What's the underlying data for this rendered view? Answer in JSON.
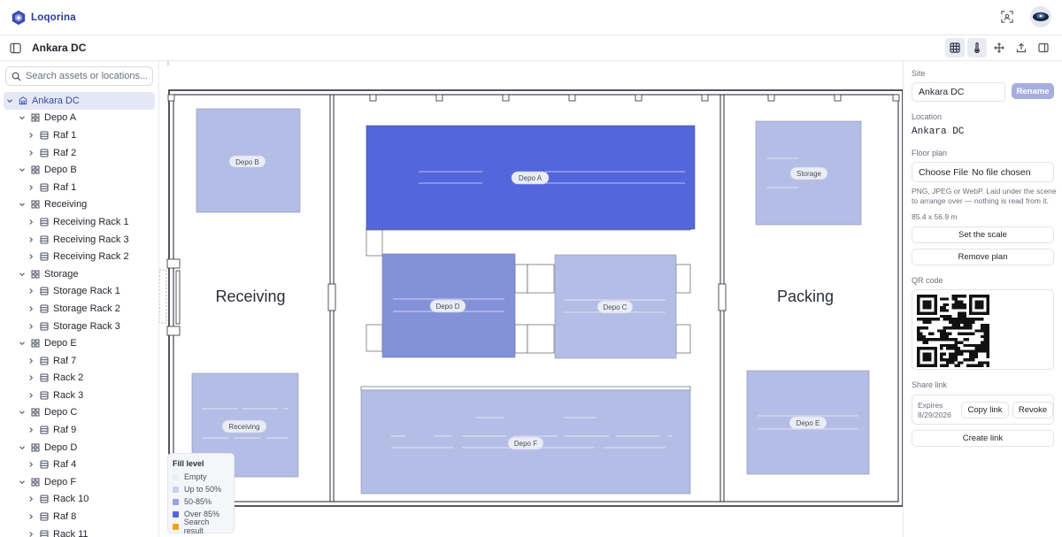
{
  "app": {
    "name": "Loqorina"
  },
  "header": {
    "title": "Ankara DC"
  },
  "search": {
    "placeholder": "Search assets or locations..."
  },
  "tree": [
    {
      "label": "Ankara DC",
      "level": 0,
      "icon": "building-icon",
      "selected": true
    },
    {
      "label": "Depo A",
      "level": 1,
      "icon": "grid-icon"
    },
    {
      "label": "Raf 1",
      "level": 2,
      "icon": "rack-icon"
    },
    {
      "label": "Raf 2",
      "level": 2,
      "icon": "rack-icon"
    },
    {
      "label": "Depo B",
      "level": 1,
      "icon": "grid-icon"
    },
    {
      "label": "Raf 1",
      "level": 2,
      "icon": "rack-icon"
    },
    {
      "label": "Receiving",
      "level": 1,
      "icon": "grid-icon"
    },
    {
      "label": "Receiving Rack 1",
      "level": 2,
      "icon": "rack-icon"
    },
    {
      "label": "Receiving Rack 3",
      "level": 2,
      "icon": "rack-icon"
    },
    {
      "label": "Receiving Rack 2",
      "level": 2,
      "icon": "rack-icon"
    },
    {
      "label": "Storage",
      "level": 1,
      "icon": "grid-icon"
    },
    {
      "label": "Storage Rack 1",
      "level": 2,
      "icon": "rack-icon"
    },
    {
      "label": "Storage Rack 2",
      "level": 2,
      "icon": "rack-icon"
    },
    {
      "label": "Storage Rack 3",
      "level": 2,
      "icon": "rack-icon"
    },
    {
      "label": "Depo E",
      "level": 1,
      "icon": "grid-icon"
    },
    {
      "label": "Raf 7",
      "level": 2,
      "icon": "rack-icon"
    },
    {
      "label": "Rack 2",
      "level": 2,
      "icon": "rack-icon"
    },
    {
      "label": "Rack 3",
      "level": 2,
      "icon": "rack-icon"
    },
    {
      "label": "Depo C",
      "level": 1,
      "icon": "grid-icon"
    },
    {
      "label": "Raf 9",
      "level": 2,
      "icon": "rack-icon"
    },
    {
      "label": "Depo D",
      "level": 1,
      "icon": "grid-icon"
    },
    {
      "label": "Raf 4",
      "level": 2,
      "icon": "rack-icon"
    },
    {
      "label": "Depo F",
      "level": 1,
      "icon": "grid-icon"
    },
    {
      "label": "Rack 10",
      "level": 2,
      "icon": "rack-icon"
    },
    {
      "label": "Raf 8",
      "level": 2,
      "icon": "rack-icon"
    },
    {
      "label": "Rack 11",
      "level": 2,
      "icon": "rack-icon"
    }
  ],
  "floor": {
    "rooms": [
      "Receiving",
      "Packing"
    ],
    "zones": [
      {
        "label": "Depo B",
        "fill": "50-85%",
        "color": "#b3bde5"
      },
      {
        "label": "Depo A",
        "fill": "Over 85%",
        "color": "#5466dc"
      },
      {
        "label": "Storage",
        "fill": "50-85%",
        "color": "#b3bde5"
      },
      {
        "label": "Depo D",
        "fill": "Over 85%",
        "color": "#8391d9"
      },
      {
        "label": "Depo C",
        "fill": "50-85%",
        "color": "#b3bde5"
      },
      {
        "label": "Receiving",
        "fill": "50-85%",
        "color": "#b3bde5"
      },
      {
        "label": "Depo F",
        "fill": "50-85%",
        "color": "#b3bde5"
      },
      {
        "label": "Depo E",
        "fill": "50-85%",
        "color": "#b3bde5"
      }
    ]
  },
  "legend": {
    "title": "Fill level",
    "items": [
      {
        "label": "Empty",
        "color": "#eceef3"
      },
      {
        "label": "Up to 50%",
        "color": "#c9d0ee"
      },
      {
        "label": "50-85%",
        "color": "#97a3e3"
      },
      {
        "label": "Over 85%",
        "color": "#5466dc"
      },
      {
        "label": "Search result",
        "color": "#f0a21b"
      }
    ]
  },
  "panel": {
    "site_label": "Site",
    "site_value": "Ankara DC",
    "rename_label": "Rename",
    "location_label": "Location",
    "location_value": "Ankara DC",
    "floor_plan_label": "Floor plan",
    "choose_file_label": "Choose File",
    "no_file_label": "No file chosen",
    "help_text": "PNG, JPEG or WebP. Laid under the scene to arrange over — nothing is read from it.",
    "dimensions": "85.4 x 56.9 m",
    "set_scale_label": "Set the scale",
    "remove_plan_label": "Remove plan",
    "qr_label": "QR code",
    "share_label": "Share link",
    "expires_label": "Expires",
    "expires_date": "8/29/2026",
    "copy_link_label": "Copy link",
    "revoke_label": "Revoke",
    "create_link_label": "Create link"
  }
}
